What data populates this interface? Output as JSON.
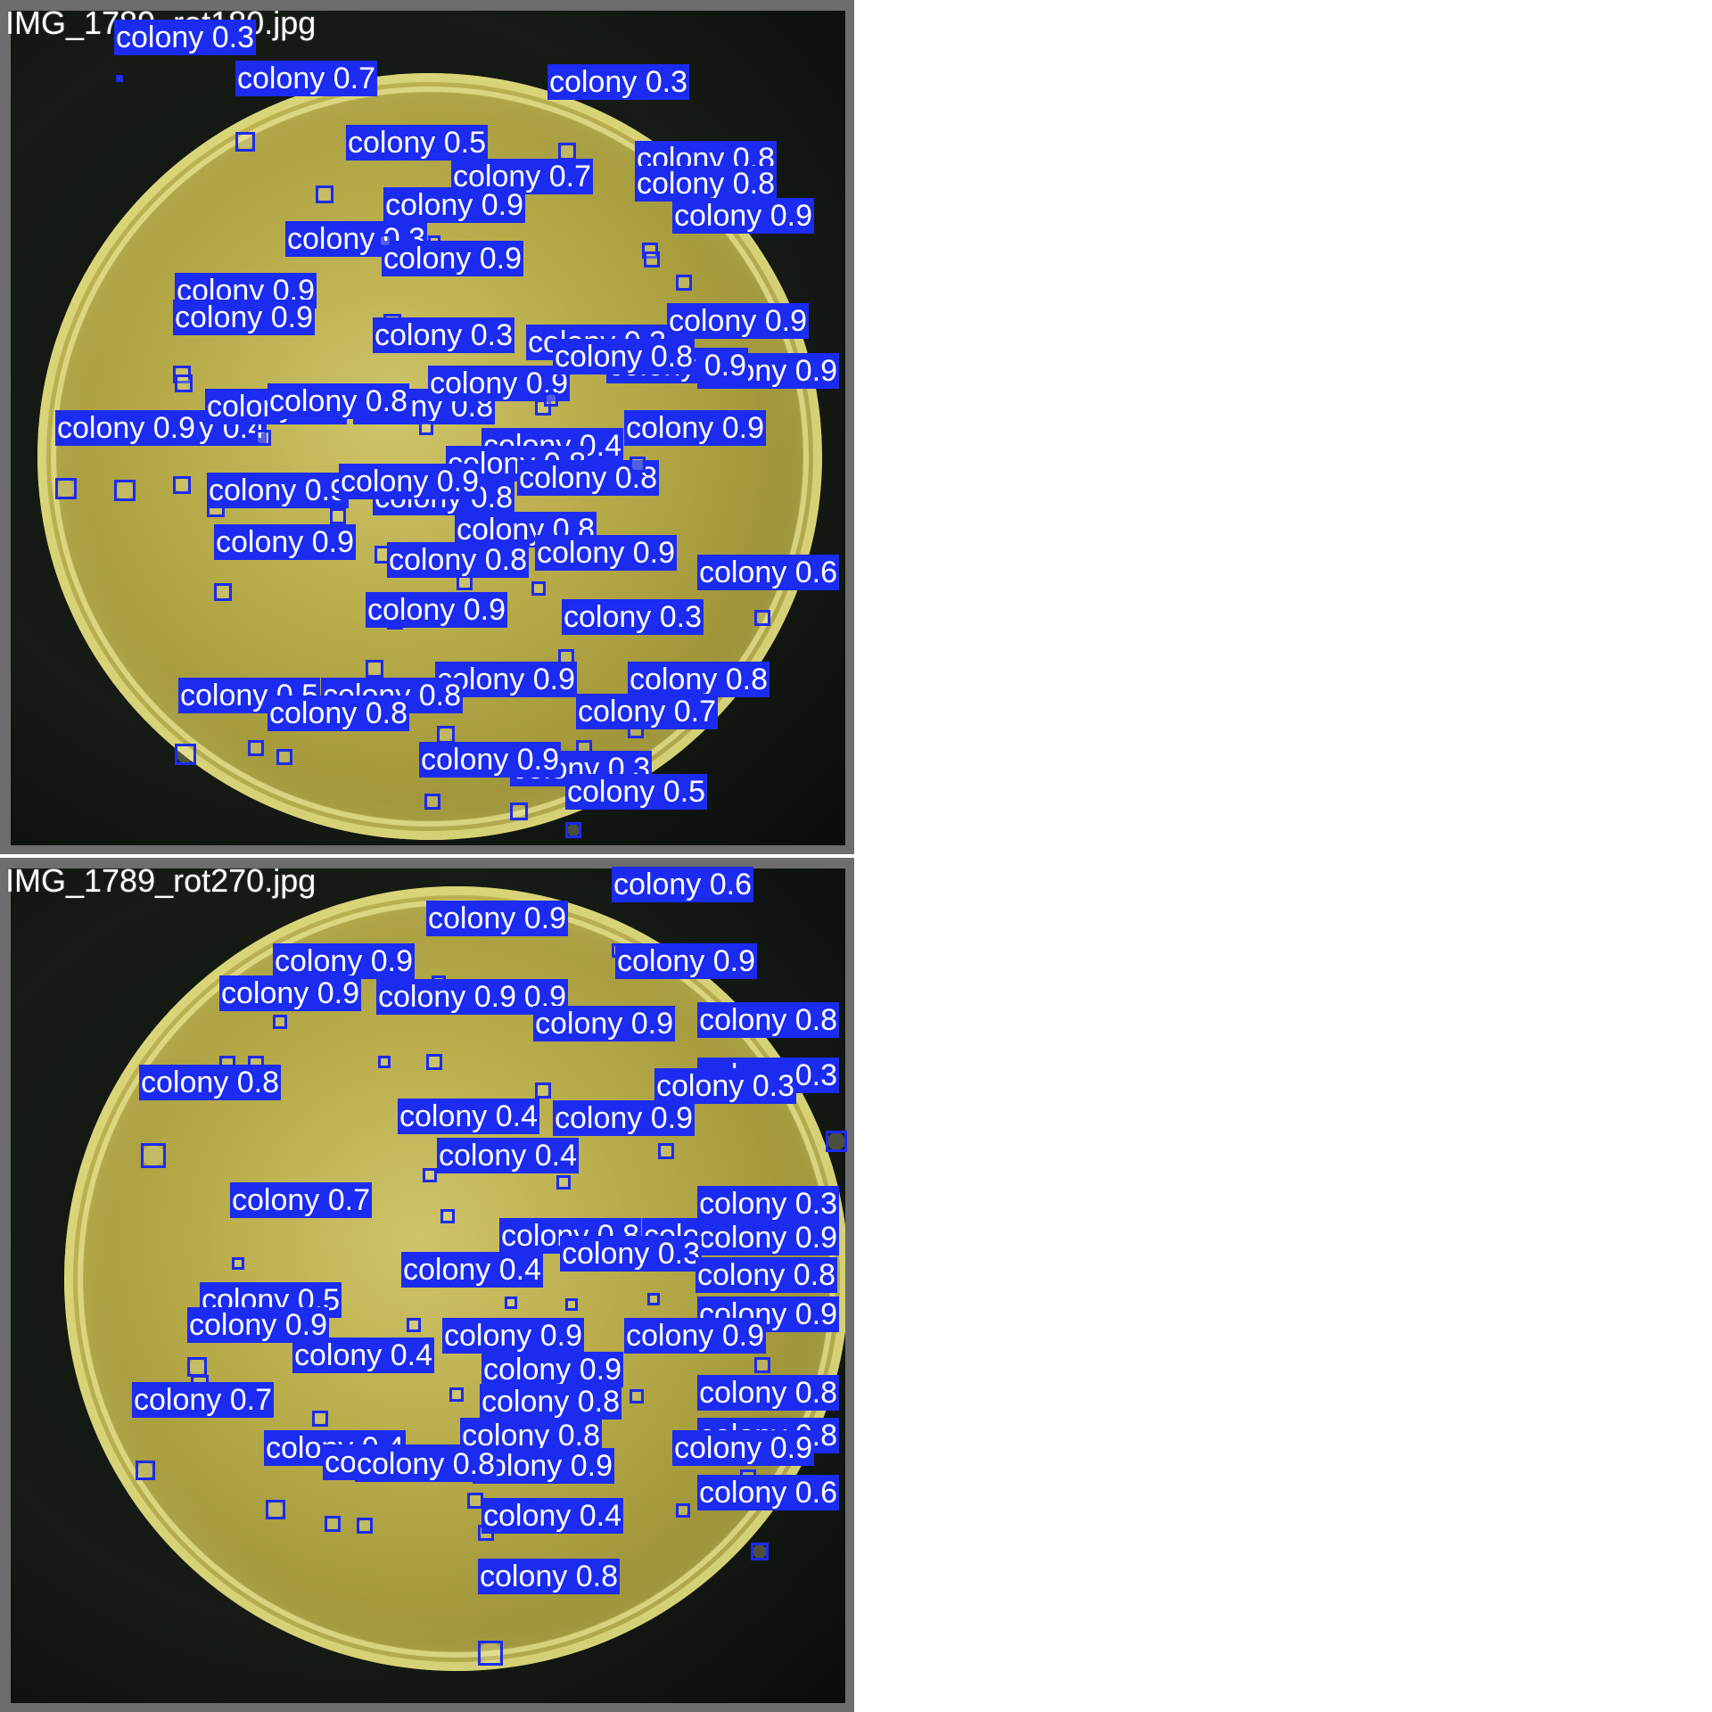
{
  "colors": {
    "box": "#1b2bf0",
    "label_text": "#ffffff",
    "frame": "#6d6d6d",
    "agar": "#b8ac4a"
  },
  "panels": [
    {
      "filename": "IMG_1789_rot180.jpg",
      "detections": [
        {
          "label": "colony 0.3"
        },
        {
          "label": "colony 0.7"
        },
        {
          "label": "colony 0.3"
        },
        {
          "label": "colony 0.5"
        },
        {
          "label": "colony 0.7"
        },
        {
          "label": "colony 0.8"
        },
        {
          "label": "colony 0.8"
        },
        {
          "label": "colony 0.9"
        },
        {
          "label": "colony 0.3"
        },
        {
          "label": "colony 0.9"
        },
        {
          "label": "colony 0.9"
        },
        {
          "label": "colony 0.9"
        },
        {
          "label": "colony 0.3"
        },
        {
          "label": "colony 0.3"
        },
        {
          "label": "colony 0.9"
        },
        {
          "label": "colony 0.9"
        },
        {
          "label": "colony 0.4"
        },
        {
          "label": "colony 0.9"
        },
        {
          "label": "colony 0.8"
        },
        {
          "label": "colony 0.8"
        },
        {
          "label": "colony 0.4"
        },
        {
          "label": "colony 0.9"
        },
        {
          "label": "colony 0.8"
        },
        {
          "label": "colony 0.8"
        },
        {
          "label": "colony 0.9"
        },
        {
          "label": "colony 0.8"
        },
        {
          "label": "colony 0.9"
        },
        {
          "label": "colony 0.8"
        },
        {
          "label": "colony 0.8"
        },
        {
          "label": "colony 0.6"
        },
        {
          "label": "colony 0.9"
        },
        {
          "label": "colony 0.3"
        },
        {
          "label": "colony 0.8"
        },
        {
          "label": "colony 0.5"
        },
        {
          "label": "colony 0.9"
        },
        {
          "label": "colony 0.7"
        },
        {
          "label": "colony 0.8"
        },
        {
          "label": "colony 0.3"
        },
        {
          "label": "colony 0.5"
        },
        {
          "label": "colony 0.9"
        },
        {
          "label": "colony 0.8"
        },
        {
          "label": "colony 0.9"
        },
        {
          "label": "colony 0.9"
        },
        {
          "label": "colony 0.8"
        },
        {
          "label": "colony 0.9"
        },
        {
          "label": "colony 0.8"
        },
        {
          "label": "colony 0.9"
        },
        {
          "label": "colony 0.9"
        }
      ]
    },
    {
      "filename": "IMG_1789_rot270.jpg",
      "detections": [
        {
          "label": "colony 0.6"
        },
        {
          "label": "colony 0.9"
        },
        {
          "label": "colony 0.9"
        },
        {
          "label": "colony 0.9"
        },
        {
          "label": "colony 0.9"
        },
        {
          "label": "colony 0.8"
        },
        {
          "label": "colony 0.9"
        },
        {
          "label": "colony 0.9"
        },
        {
          "label": "colony 0.9"
        },
        {
          "label": "colony 0.8"
        },
        {
          "label": "colony 0.8"
        },
        {
          "label": "colony 0.3"
        },
        {
          "label": "colony 0.3"
        },
        {
          "label": "colony 0.4"
        },
        {
          "label": "colony 0.9"
        },
        {
          "label": "colony 0.4"
        },
        {
          "label": "colony 0.7"
        },
        {
          "label": "colony 0.8"
        },
        {
          "label": "colony 0.8"
        },
        {
          "label": "colony 0.3"
        },
        {
          "label": "colony 0.9"
        },
        {
          "label": "colony 0.3"
        },
        {
          "label": "colony 0.4"
        },
        {
          "label": "colony 0.8"
        },
        {
          "label": "colony 0.5"
        },
        {
          "label": "colony 0.9"
        },
        {
          "label": "colony 0.9"
        },
        {
          "label": "colony 0.9"
        },
        {
          "label": "colony 0.9"
        },
        {
          "label": "colony 0.4"
        },
        {
          "label": "colony 0.9"
        },
        {
          "label": "colony 0.8"
        },
        {
          "label": "colony 0.7"
        },
        {
          "label": "colony 0.8"
        },
        {
          "label": "colony 0.8"
        },
        {
          "label": "colony 0.4"
        },
        {
          "label": "colony 0.8"
        },
        {
          "label": "colony 0.9"
        },
        {
          "label": "colony 0.6"
        },
        {
          "label": "colony 0.9"
        },
        {
          "label": "colony 0.4"
        },
        {
          "label": "colony 0.8"
        },
        {
          "label": "colony 0.9"
        },
        {
          "label": "colony 0.8"
        }
      ]
    }
  ]
}
